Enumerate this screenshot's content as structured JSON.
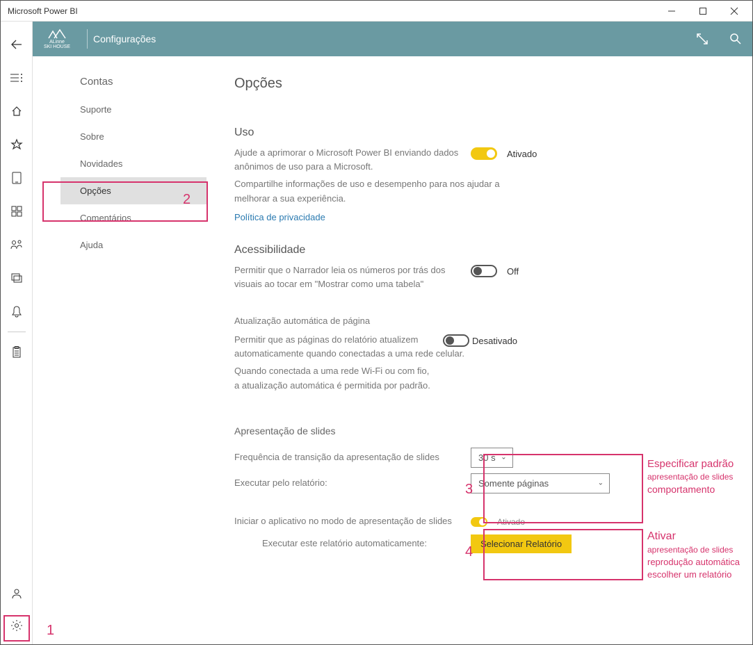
{
  "titlebar": {
    "app_name": "Microsoft Power BI"
  },
  "header": {
    "crumb": "Configurações",
    "logo_line1": "ALinne",
    "logo_line2": "SKI HOUSE"
  },
  "sidenav": {
    "heading": "Contas",
    "items": [
      "Suporte",
      "Sobre",
      "Novidades",
      "Opções",
      "Comentários",
      "Ajuda"
    ],
    "selected": "Opções"
  },
  "main": {
    "title": "Opções",
    "usage": {
      "heading": "Uso",
      "label": "Ajude a aprimorar o Microsoft Power BI enviando dados anônimos de uso para a Microsoft.",
      "state": "Ativado",
      "note": "Compartilhe informações de uso e desempenho para nos ajudar a melhorar a sua experiência.",
      "link": "Política de privacidade"
    },
    "accessibility": {
      "heading": "Acessibilidade",
      "label": "Permitir que o Narrador leia os números por trás dos visuais ao tocar em \"Mostrar como uma tabela\"",
      "state": "Off"
    },
    "autorefresh": {
      "heading": "Atualização automática de página",
      "label": "Permitir que as páginas do relatório atualizem automaticamente quando conectadas a uma rede celular.",
      "state": "Desativado",
      "note1": "Quando conectada a uma rede Wi-Fi ou com fio,",
      "note2": "a atualização automática é permitida por padrão."
    },
    "slideshow": {
      "heading": "Apresentação de slides",
      "freq_label": "Frequência de transição da apresentação de slides",
      "freq_value": "30 s",
      "run_label": "Executar pelo relatório:",
      "run_value": "Somente páginas",
      "start_label": "Iniciar o aplicativo no modo de apresentação de slides",
      "start_state": "Ativado",
      "autorun_label": "Executar este relatório automaticamente:",
      "select_btn": "Selecionar Relatório"
    }
  },
  "annotations": {
    "n1": "1",
    "n2": "2",
    "n3": "3",
    "n4": "4",
    "t3a": "Especificar padrão",
    "t3b": "apresentação de slides",
    "t3c": "comportamento",
    "t4a": "Ativar",
    "t4b": "apresentação de slides",
    "t4c": "reprodução automática",
    "t4d": "escolher um relatório"
  }
}
